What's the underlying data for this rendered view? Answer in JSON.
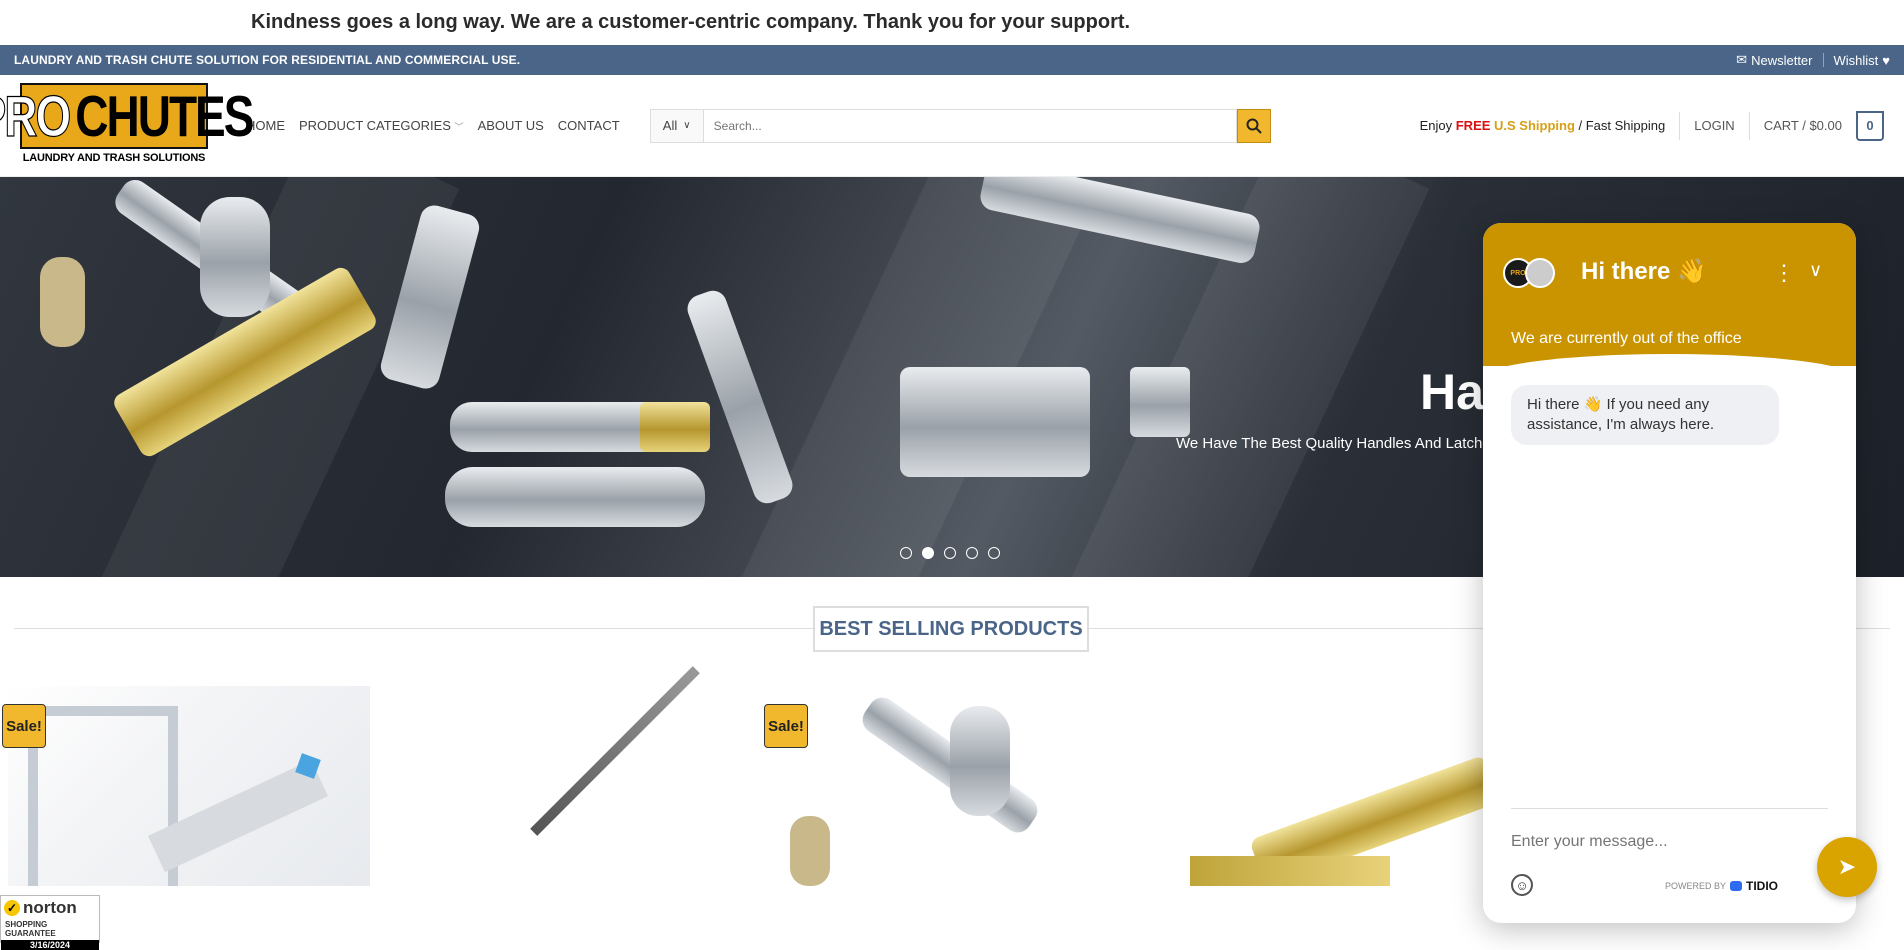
{
  "announcement": "Kindness goes a long way. We are a customer-centric company. Thank you for your support.",
  "topbar": {
    "tagline": "LAUNDRY AND TRASH CHUTE SOLUTION FOR RESIDENTIAL AND COMMERCIAL USE.",
    "newsletter": "Newsletter",
    "wishlist": "Wishlist"
  },
  "logo": {
    "pro": "PRO",
    "chutes": "CHUTES",
    "sub": "LAUNDRY AND TRASH SOLUTIONS"
  },
  "nav": {
    "home": "HOME",
    "categories": "PRODUCT CATEGORIES",
    "about": "ABOUT US",
    "contact": "CONTACT"
  },
  "search": {
    "category": "All",
    "placeholder": "Search..."
  },
  "shipping": {
    "enjoy": "Enjoy ",
    "free": "FREE",
    "us": " U.S Shipping",
    "rest": " / Fast Shipping"
  },
  "login": "LOGIN",
  "cart": {
    "label": "CART / $0.00",
    "count": "0"
  },
  "hero": {
    "title": "Ha",
    "subtitle": "We Have The Best Quality Handles And Latche",
    "active_slide": 2,
    "slide_count": 5
  },
  "section_title": "BEST SELLING PRODUCTS",
  "sale_label": "Sale!",
  "norton": {
    "brand": "norton",
    "guarantee": "SHOPPING GUARANTEE",
    "date": "3/16/2024"
  },
  "chat": {
    "title": "Hi there 👋",
    "status": "We are currently out of the office",
    "message": "Hi there 👋 If you need any assistance, I'm always here.",
    "input_placeholder": "Enter your message...",
    "powered_by": "POWERED BY",
    "brand": "TIDIO"
  },
  "colors": {
    "accent": "#f1b82d",
    "topbar": "#4a6587",
    "chat": "#c99400"
  }
}
